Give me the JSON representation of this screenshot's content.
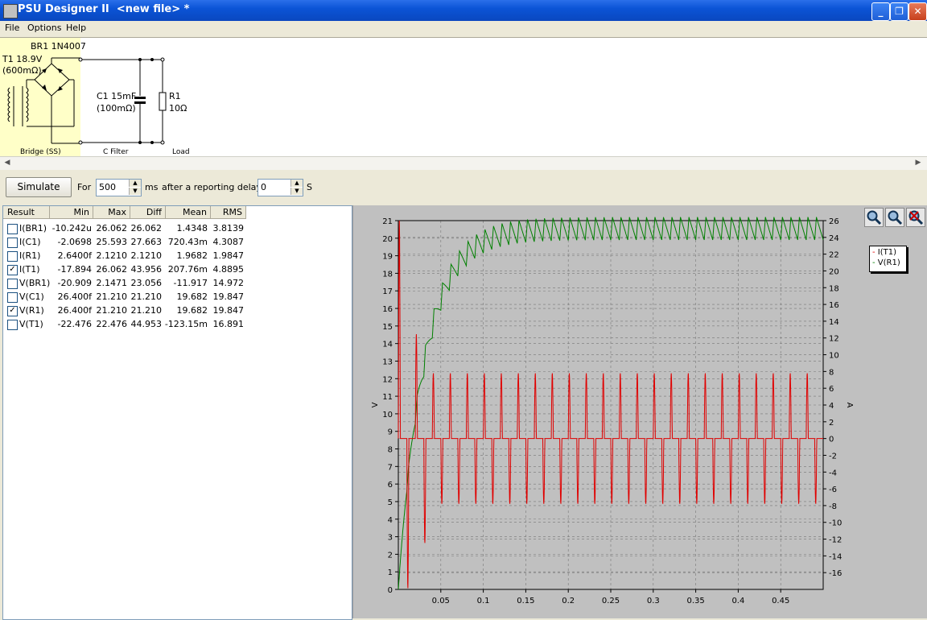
{
  "window": {
    "title": "PSU Designer II  <new file> *"
  },
  "menu": [
    "File",
    "Options",
    "Help"
  ],
  "schematic": {
    "bridge_label": "BR1 1N4007",
    "transformer_label_1": "T1 18.9V",
    "transformer_label_2": "(600mΩ)",
    "capacitor_label_1": "C1 15mF",
    "capacitor_label_2": "(100mΩ)",
    "resistor_label_1": "R1",
    "resistor_label_2": "10Ω",
    "stage_bridge": "Bridge (SS)",
    "stage_filter": "C Filter",
    "stage_load": "Load"
  },
  "toolbar": {
    "simulate_label": "Simulate",
    "for_label": "For",
    "duration_value": "500",
    "duration_unit": "ms",
    "delay_label": "after a reporting delay of",
    "delay_value": "0",
    "delay_unit": "S"
  },
  "results": {
    "columns": [
      "Result",
      "Min",
      "Max",
      "Diff",
      "Mean",
      "RMS"
    ],
    "rows": [
      {
        "name": "I(BR1)",
        "checked": false,
        "min": "-10.242u",
        "max": "26.062",
        "diff": "26.062",
        "mean": "1.4348",
        "rms": "3.8139"
      },
      {
        "name": "I(C1)",
        "checked": false,
        "min": "-2.0698",
        "max": "25.593",
        "diff": "27.663",
        "mean": "720.43m",
        "rms": "4.3087"
      },
      {
        "name": "I(R1)",
        "checked": false,
        "min": "2.6400f",
        "max": "2.1210",
        "diff": "2.1210",
        "mean": "1.9682",
        "rms": "1.9847"
      },
      {
        "name": "I(T1)",
        "checked": true,
        "min": "-17.894",
        "max": "26.062",
        "diff": "43.956",
        "mean": "207.76m",
        "rms": "4.8895"
      },
      {
        "name": "V(BR1)",
        "checked": false,
        "min": "-20.909",
        "max": "2.1471",
        "diff": "23.056",
        "mean": "-11.917",
        "rms": "14.972"
      },
      {
        "name": "V(C1)",
        "checked": false,
        "min": "26.400f",
        "max": "21.210",
        "diff": "21.210",
        "mean": "19.682",
        "rms": "19.847"
      },
      {
        "name": "V(R1)",
        "checked": true,
        "min": "26.400f",
        "max": "21.210",
        "diff": "21.210",
        "mean": "19.682",
        "rms": "19.847"
      },
      {
        "name": "V(T1)",
        "checked": false,
        "min": "-22.476",
        "max": "22.476",
        "diff": "44.953",
        "mean": "-123.15m",
        "rms": "16.891"
      }
    ]
  },
  "chart_data": {
    "type": "line",
    "ylabel": "V",
    "y2label": "A",
    "xlim": [
      0,
      0.5
    ],
    "ylim": [
      0,
      21
    ],
    "y2lim": [
      -18,
      26
    ],
    "xticks": [
      "0.05",
      "0.1",
      "0.15",
      "0.2",
      "0.25",
      "0.3",
      "0.35",
      "0.4",
      "0.45"
    ],
    "yticks": [
      "0",
      "1",
      "2",
      "3",
      "4",
      "5",
      "6",
      "7",
      "8",
      "9",
      "10",
      "11",
      "12",
      "13",
      "14",
      "15",
      "16",
      "17",
      "18",
      "19",
      "20",
      "21"
    ],
    "y2ticks": [
      "-16",
      "-14",
      "-12",
      "-10",
      "-8",
      "-6",
      "-4",
      "-2",
      "0",
      "2",
      "4",
      "6",
      "8",
      "10",
      "12",
      "14",
      "16",
      "18",
      "20",
      "22",
      "24",
      "26"
    ],
    "grid": true,
    "legend_position": "top-right",
    "series": [
      {
        "name": "I(T1)",
        "color": "#e00000",
        "axis": "right",
        "period_s": 0.02,
        "peak_A": 7.8,
        "trough_A": -7.8,
        "first_peak_A": 26.06,
        "first_trough_A": -17.89
      },
      {
        "name": "V(R1)",
        "color": "#008000",
        "axis": "left",
        "steady_max_V": 21.2,
        "steady_min_V": 19.9,
        "time_constant_s": 0.03
      }
    ]
  }
}
